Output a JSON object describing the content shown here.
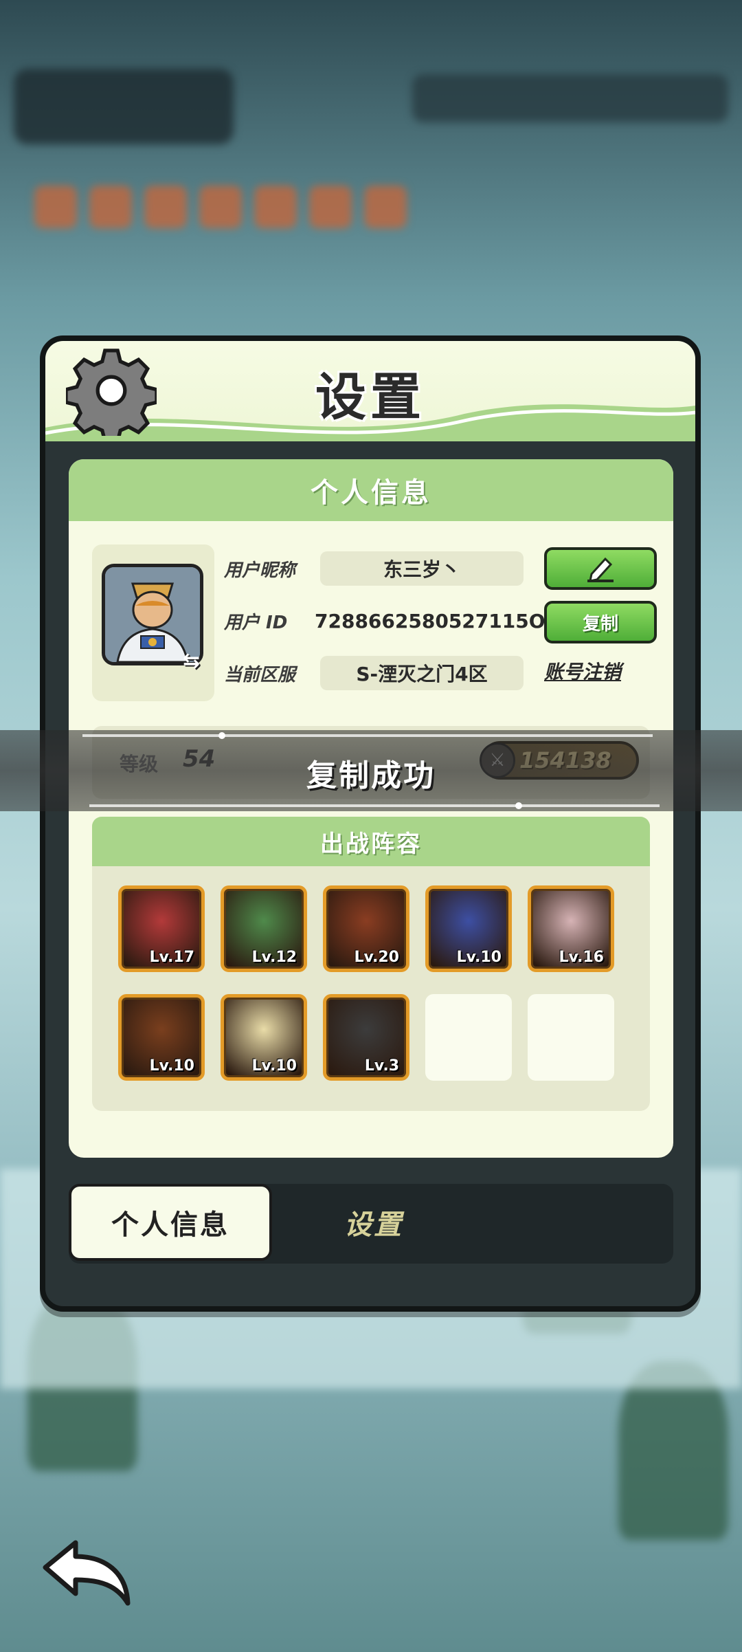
{
  "dialog": {
    "title": "设置"
  },
  "profile_panel": {
    "header": "个人信息",
    "nickname_label": "用户昵称",
    "nickname_value": "东三岁丶",
    "id_label": "用户  ID",
    "id_value": "7288662580527115O",
    "server_label": "当前区服",
    "server_value": "S-湮灭之门4区",
    "copy_button": "复制",
    "logout_link": "账号注销",
    "level_label": "等级",
    "level_value": "54",
    "power_value": "154138"
  },
  "lineup": {
    "header": "出战阵容",
    "heroes": [
      {
        "lv": "Lv.17",
        "color": "#b33a3a"
      },
      {
        "lv": "Lv.12",
        "color": "#4f8a4b"
      },
      {
        "lv": "Lv.20",
        "color": "#8a3d22"
      },
      {
        "lv": "Lv.10",
        "color": "#3d4fa3"
      },
      {
        "lv": "Lv.16",
        "color": "#d6b3b5"
      },
      {
        "lv": "Lv.10",
        "color": "#7a3f1e"
      },
      {
        "lv": "Lv.10",
        "color": "#e9dca8"
      },
      {
        "lv": "Lv.3",
        "color": "#3c3c3c"
      }
    ]
  },
  "toast": {
    "text": "复制成功"
  },
  "tabs": {
    "active": "个人信息",
    "inactive": "设置"
  },
  "colors": {
    "accent_green": "#4fae38",
    "header_green": "#a9d58a",
    "panel_bg": "#f7fae4",
    "hero_border": "#e39b28"
  }
}
